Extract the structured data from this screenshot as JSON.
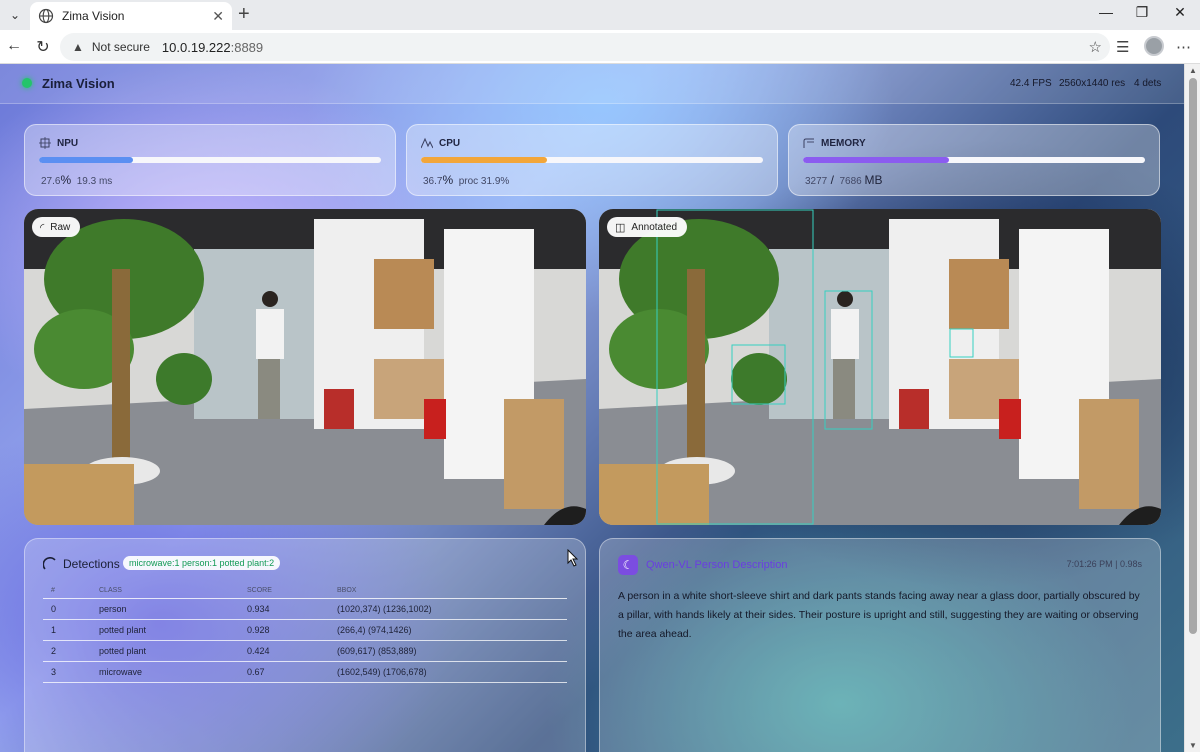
{
  "browser": {
    "tab_title": "Zima Vision",
    "not_secure": "Not secure",
    "url_host": "10.0.19.222",
    "url_port": ":8889"
  },
  "app": {
    "brand": "Zima Vision",
    "fps": "42.4 FPS",
    "resolution": "2560x1440 res",
    "dets": "4 dets"
  },
  "metrics": {
    "npu": {
      "label": "NPU",
      "value": "27.6",
      "unit": "%",
      "extra": "19.3 ms",
      "fraction": 0.276,
      "color": "#5b8ff2"
    },
    "cpu": {
      "label": "CPU",
      "value": "36.7",
      "unit": "%",
      "extra": "proc  31.9%",
      "fraction": 0.367,
      "color": "#f2a63a"
    },
    "memory": {
      "label": "MEMORY",
      "value": "3277",
      "unit": " /",
      "extra": "7686",
      "unit2": "MB",
      "fraction": 0.426,
      "color": "#8b5cf0"
    }
  },
  "views": {
    "raw_label": "Raw",
    "annotated_label": "Annotated"
  },
  "detections": {
    "title": "Detections",
    "summary": "microwave:1 person:1 potted plant:2",
    "headers": [
      "#",
      "CLASS",
      "SCORE",
      "BBOX"
    ],
    "rows": [
      [
        "0",
        "person",
        "0.934",
        "(1020,374) (1236,1002)"
      ],
      [
        "1",
        "potted plant",
        "0.928",
        "(266,4) (974,1426)"
      ],
      [
        "2",
        "potted plant",
        "0.424",
        "(609,617) (853,889)"
      ],
      [
        "3",
        "microwave",
        "0.67",
        "(1602,549) (1706,678)"
      ]
    ]
  },
  "description": {
    "title": "Qwen-VL Person Description",
    "time": "7:01:26 PM | 0.98s",
    "text": "A person in a white short-sleeve shirt and dark pants stands facing away near a glass door, partially obscured by a pillar, with hands likely at their sides. Their posture is upright and still, suggesting they are waiting or observing the area ahead."
  },
  "icons": {
    "menu": "chevron-down-icon",
    "globe": "globe-icon",
    "back": "back-arrow-icon",
    "reload": "reload-icon",
    "star": "star-icon",
    "collections": "collections-icon",
    "more": "more-icon"
  }
}
